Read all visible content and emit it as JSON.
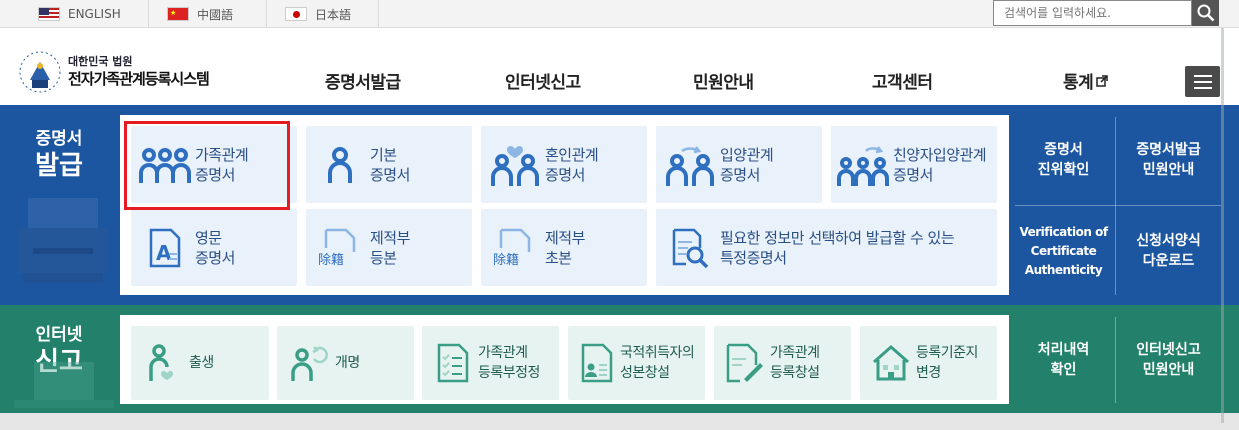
{
  "lang": {
    "english": "ENGLISH",
    "chinese": "中國語",
    "japanese": "日本語"
  },
  "search": {
    "placeholder": "검색어를 입력하세요."
  },
  "logo": {
    "line1": "대한민국 법원",
    "line2": "전자가족관계등록시스템"
  },
  "gnav": [
    {
      "label": "증명서발급"
    },
    {
      "label": "인터넷신고"
    },
    {
      "label": "민원안내"
    },
    {
      "label": "고객센터"
    },
    {
      "label": "통계"
    }
  ],
  "cert": {
    "title_small": "증명서",
    "title_big": "발급",
    "cards": [
      {
        "line1": "가족관계",
        "line2": "증명서"
      },
      {
        "line1": "기본",
        "line2": "증명서"
      },
      {
        "line1": "혼인관계",
        "line2": "증명서"
      },
      {
        "line1": "입양관계",
        "line2": "증명서"
      },
      {
        "line1": "친양자입양관계",
        "line2": "증명서"
      },
      {
        "line1": "영문",
        "line2": "증명서"
      },
      {
        "line1": "제적부",
        "line2": "등본"
      },
      {
        "line1": "제적부",
        "line2": "초본"
      },
      {
        "line1": "필요한 정보만 선택하여 발급할 수 있는",
        "line2": "특정증명서"
      }
    ],
    "icon_text": {
      "a": "A",
      "jejeok": "除籍"
    },
    "side": [
      {
        "line1": "증명서",
        "line2": "진위확인"
      },
      {
        "line1": "증명서발급",
        "line2": "민원안내"
      },
      {
        "line1": "Verification of",
        "line2": "Certificate",
        "line3": "Authenticity"
      },
      {
        "line1": "신청서양식",
        "line2": "다운로드"
      }
    ]
  },
  "report": {
    "title_small": "인터넷",
    "title_big": "신고",
    "cards": [
      {
        "line1": "출생",
        "line2": ""
      },
      {
        "line1": "개명",
        "line2": ""
      },
      {
        "line1": "가족관계",
        "line2": "등록부정정"
      },
      {
        "line1": "국적취득자의",
        "line2": "성본창설"
      },
      {
        "line1": "가족관계",
        "line2": "등록창설"
      },
      {
        "line1": "등록기준지",
        "line2": "변경"
      }
    ],
    "side": [
      {
        "line1": "처리내역",
        "line2": "확인"
      },
      {
        "line1": "인터넷신고",
        "line2": "민원안내"
      }
    ]
  },
  "colors": {
    "blue": "#1d56a0",
    "green": "#22806b",
    "accent": "#e51c23",
    "icon_blue": "#2f6fc0",
    "icon_green": "#3a9e86"
  }
}
